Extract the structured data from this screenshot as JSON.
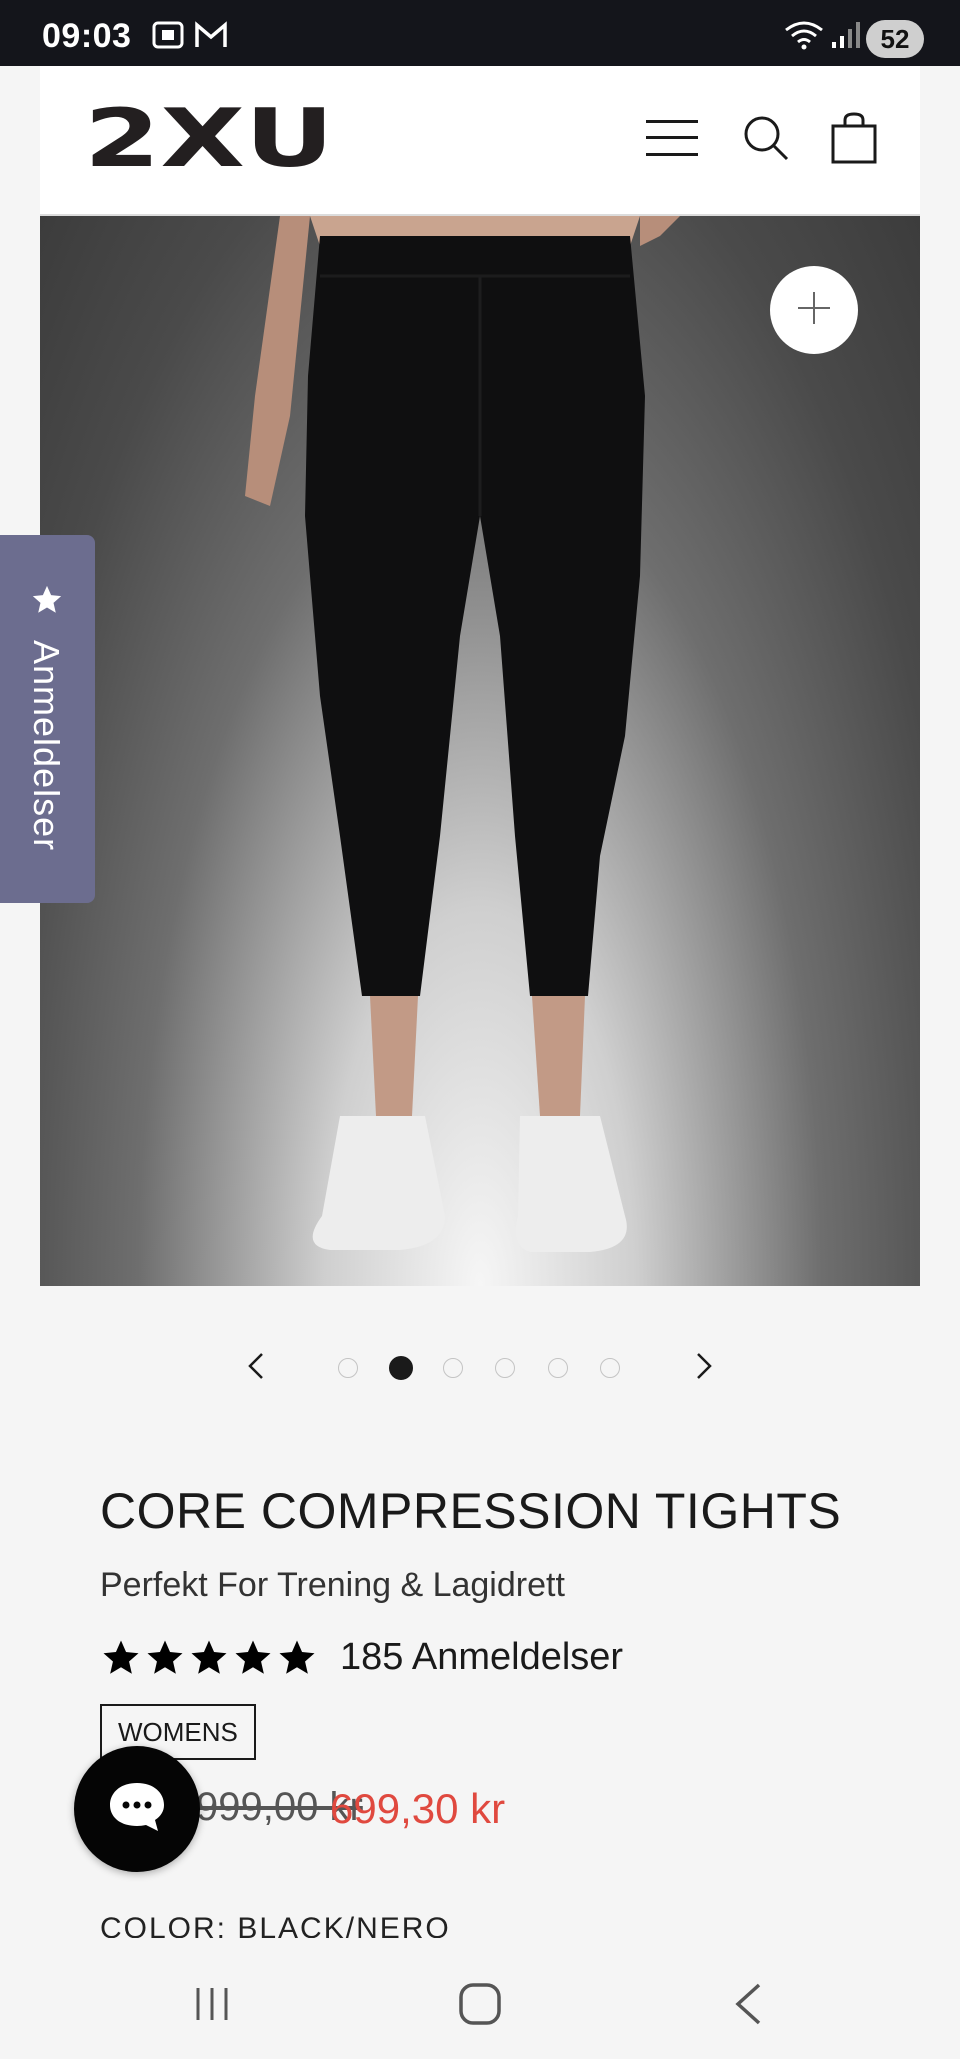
{
  "status_bar": {
    "time": "09:03",
    "battery": "52"
  },
  "header": {
    "logo_text": "2XU"
  },
  "reviews_tab": {
    "label": "Anmeldelser"
  },
  "carousel": {
    "slide_count": 6,
    "active_slide": 2
  },
  "product": {
    "title": "CORE COMPRESSION TIGHTS",
    "subtitle": "Perfekt For Trening & Lagidrett",
    "rating_stars": 5,
    "review_count": "185 Anmeldelser",
    "tag": "WOMENS",
    "old_price": "999,00 kr",
    "price": "699,30 kr",
    "color_label": "COLOR: BLACK/NERO"
  },
  "colors": {
    "accent_price": "#e0493f",
    "reviews_tab": "#6c6d8f"
  }
}
